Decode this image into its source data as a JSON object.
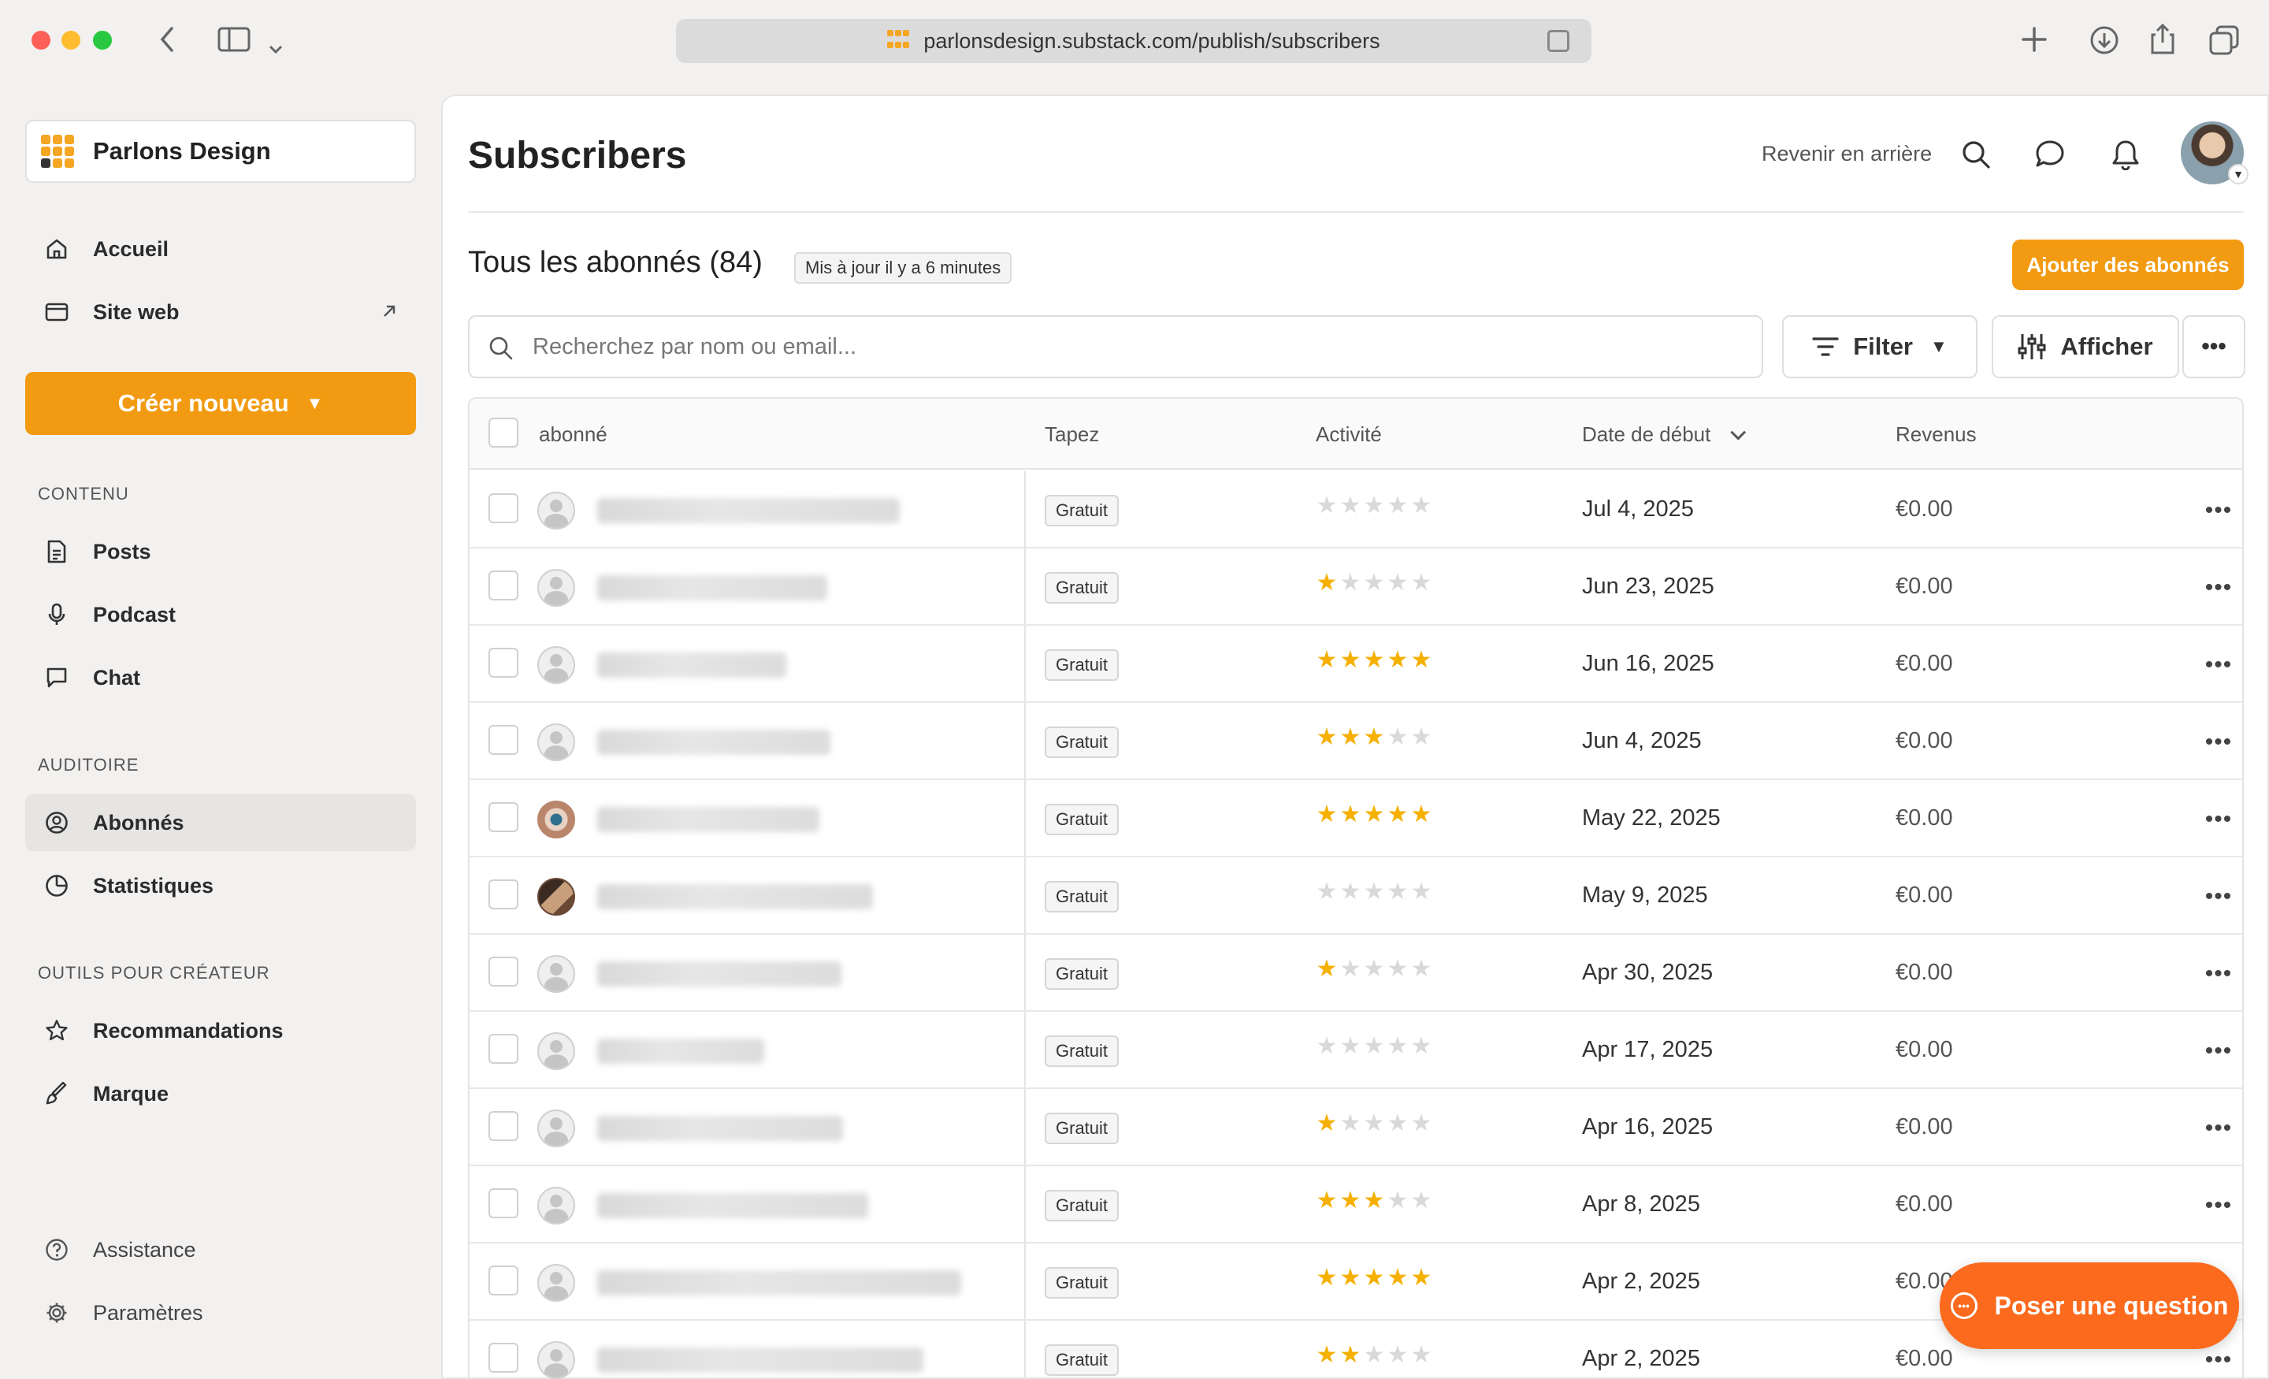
{
  "browser": {
    "url": "parlonsdesign.substack.com/publish/subscribers"
  },
  "sidebar": {
    "publication_name": "Parlons Design",
    "nav_top": [
      {
        "label": "Accueil",
        "icon": "home-icon"
      },
      {
        "label": "Site web",
        "icon": "browser-window-icon"
      }
    ],
    "create_label": "Créer nouveau",
    "sections": {
      "content": "CONTENU",
      "audience": "AUDITOIRE",
      "tools": "OUTILS POUR CRÉATEUR"
    },
    "content_items": [
      {
        "label": "Posts",
        "icon": "document-icon"
      },
      {
        "label": "Podcast",
        "icon": "microphone-icon"
      },
      {
        "label": "Chat",
        "icon": "chat-bubble-icon"
      }
    ],
    "audience_items": [
      {
        "label": "Abonnés",
        "icon": "user-circle-icon"
      },
      {
        "label": "Statistiques",
        "icon": "pie-chart-icon"
      }
    ],
    "tools_items": [
      {
        "label": "Recommandations",
        "icon": "star-icon"
      },
      {
        "label": "Marque",
        "icon": "paint-brush-icon"
      }
    ],
    "bottom_items": [
      {
        "label": "Assistance",
        "icon": "help-circle-icon"
      },
      {
        "label": "Paramètres",
        "icon": "gear-icon"
      }
    ]
  },
  "header": {
    "title": "Subscribers",
    "back_link": "Revenir en arrière"
  },
  "subscribers": {
    "heading": "Tous les abonnés (84)",
    "updated_badge": "Mis à jour il y a 6 minutes",
    "add_button": "Ajouter des abonnés",
    "search_placeholder": "Recherchez par nom ou email...",
    "filter_label": "Filter",
    "display_label": "Afficher",
    "columns": [
      "abonné",
      "Tapez",
      "Activité",
      "Date de début",
      "Revenus"
    ],
    "rows": [
      {
        "type": "Gratuit",
        "activity": 0,
        "date": "Jul 4, 2025",
        "revenue": "€0.00"
      },
      {
        "type": "Gratuit",
        "activity": 1,
        "date": "Jun 23, 2025",
        "revenue": "€0.00"
      },
      {
        "type": "Gratuit",
        "activity": 5,
        "date": "Jun 16, 2025",
        "revenue": "€0.00"
      },
      {
        "type": "Gratuit",
        "activity": 3,
        "date": "Jun 4, 2025",
        "revenue": "€0.00"
      },
      {
        "type": "Gratuit",
        "activity": 5,
        "date": "May 22, 2025",
        "revenue": "€0.00"
      },
      {
        "type": "Gratuit",
        "activity": 0,
        "date": "May 9, 2025",
        "revenue": "€0.00"
      },
      {
        "type": "Gratuit",
        "activity": 1,
        "date": "Apr 30, 2025",
        "revenue": "€0.00"
      },
      {
        "type": "Gratuit",
        "activity": 0,
        "date": "Apr 17, 2025",
        "revenue": "€0.00"
      },
      {
        "type": "Gratuit",
        "activity": 1,
        "date": "Apr 16, 2025",
        "revenue": "€0.00"
      },
      {
        "type": "Gratuit",
        "activity": 3,
        "date": "Apr 8, 2025",
        "revenue": "€0.00"
      },
      {
        "type": "Gratuit",
        "activity": 5,
        "date": "Apr 2, 2025",
        "revenue": "€0.00"
      },
      {
        "type": "Gratuit",
        "activity": 2,
        "date": "Apr 2, 2025",
        "revenue": "€0.00"
      }
    ]
  },
  "floating": {
    "ask_label": "Poser une question"
  },
  "colors": {
    "accent": "#f29b12",
    "ask_button": "#fb6a1d",
    "star_on": "#f5b000",
    "star_off": "#d9d9d9"
  }
}
